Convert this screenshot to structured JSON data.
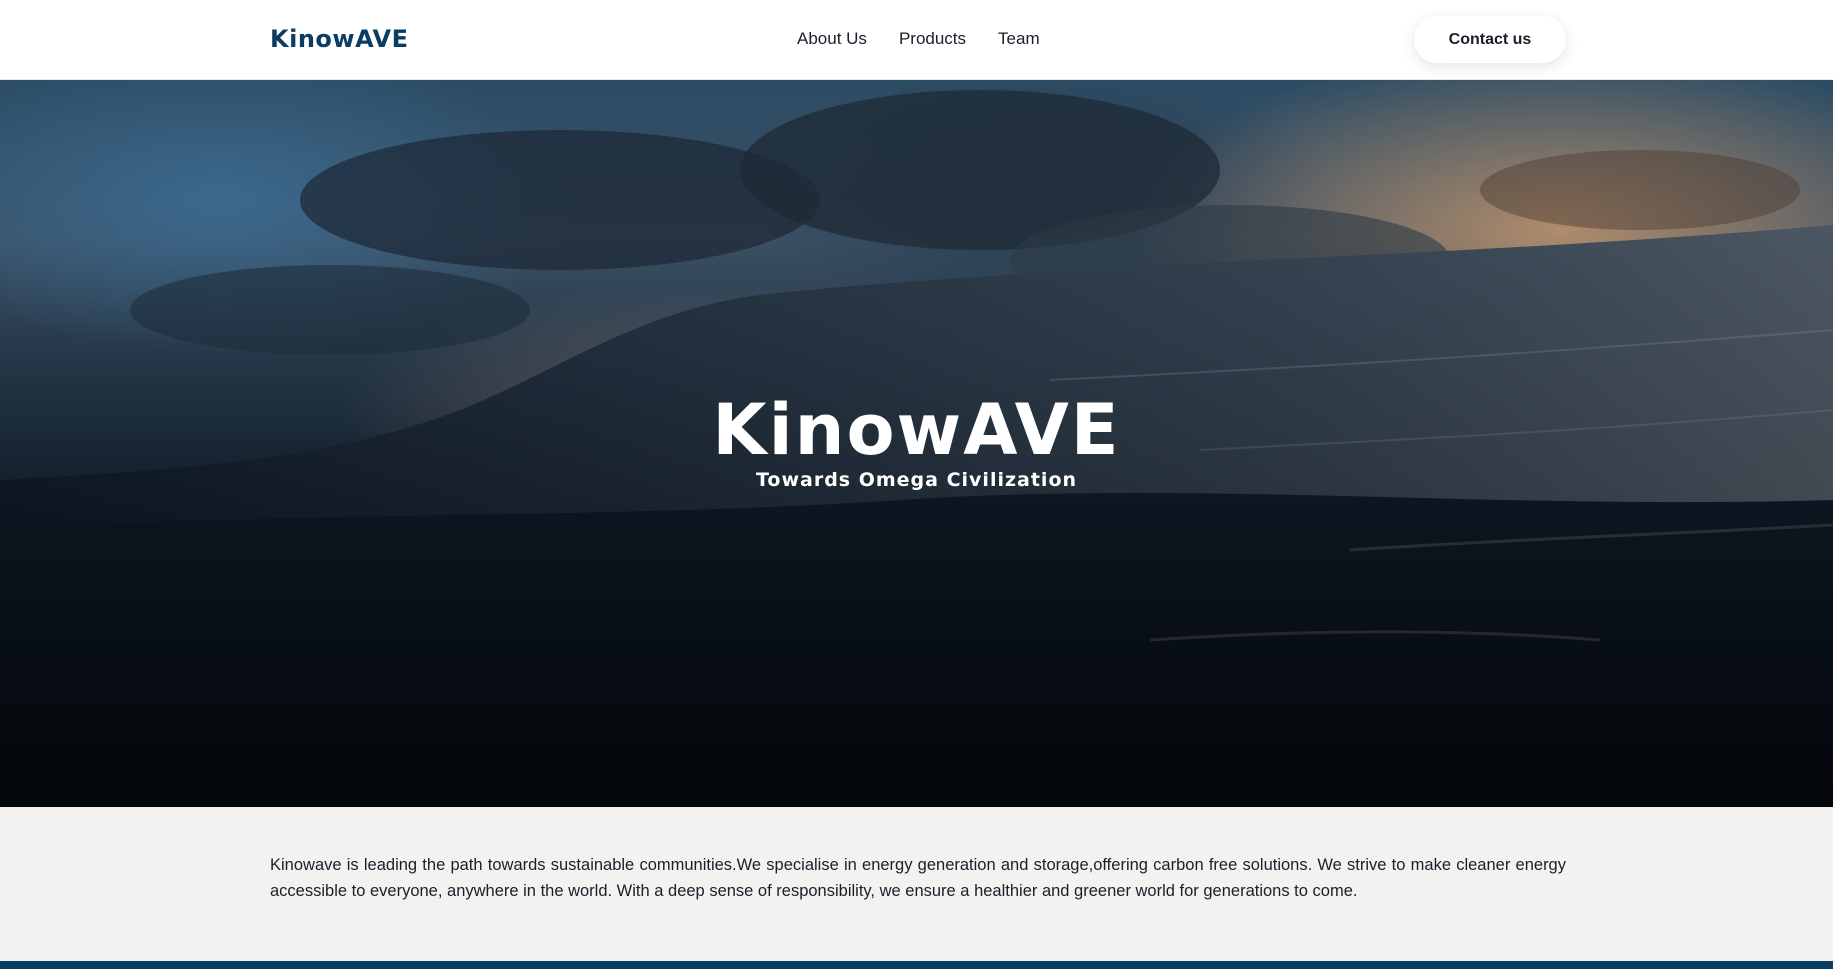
{
  "header": {
    "logo": "KinowAVE",
    "nav": [
      {
        "label": "About Us"
      },
      {
        "label": "Products"
      },
      {
        "label": "Team"
      }
    ],
    "contact_label": "Contact us"
  },
  "hero": {
    "title": "KinowAVE",
    "subtitle": "Towards Omega Civilization"
  },
  "about": {
    "text": "Kinowave is leading the path towards sustainable communities.We specialise in energy generation and storage,offering carbon free solutions. We strive to make cleaner energy accessible to everyone, anywhere in the world. With a deep sense of responsibility, we ensure a healthier and greener world for generations to come."
  },
  "colors": {
    "brand": "#0b3d63",
    "text": "#1a1f2b",
    "about_background": "#f3f2f0"
  }
}
